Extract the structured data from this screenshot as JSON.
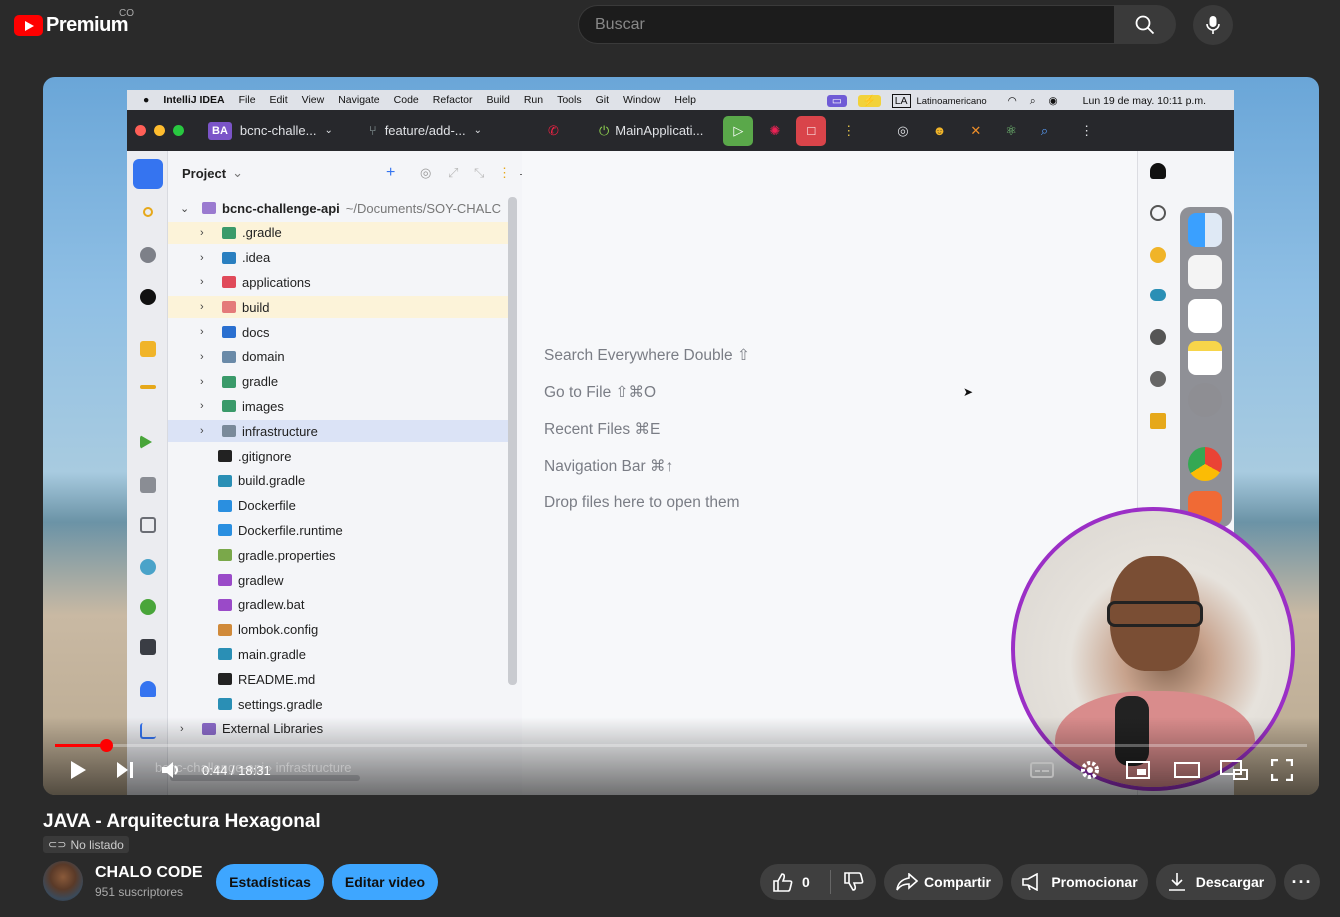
{
  "header": {
    "logo_text": "Premium",
    "country": "CO",
    "search_placeholder": "Buscar"
  },
  "ide": {
    "menubar": {
      "items": [
        "IntelliJ IDEA",
        "File",
        "Edit",
        "View",
        "Navigate",
        "Code",
        "Refactor",
        "Build",
        "Run",
        "Tools",
        "Git",
        "Window",
        "Help"
      ],
      "input_lang": "Latinoamericano",
      "clock": "Lun 19 de may.  10:11 p.m."
    },
    "toolbar": {
      "project_badge": "BA",
      "project": "bcnc-challe...",
      "branch": "feature/add-...",
      "run_config": "MainApplicati..."
    },
    "project_panel": {
      "title": "Project",
      "root": {
        "name": "bcnc-challenge-api",
        "path": "~/Documents/SOY-CHALC"
      },
      "folders": [
        ".gradle",
        ".idea",
        "applications",
        "build",
        "docs",
        "domain",
        "gradle",
        "images",
        "infrastructure"
      ],
      "files": [
        ".gitignore",
        "build.gradle",
        "Dockerfile",
        "Dockerfile.runtime",
        "gradle.properties",
        "gradlew",
        "gradlew.bat",
        "lombok.config",
        "main.gradle",
        "README.md",
        "settings.gradle"
      ],
      "external": "External Libraries"
    },
    "editor_tips": [
      "Search Everywhere Double ⇧",
      "Go to File ⇧⌘O",
      "Recent Files ⌘E",
      "Navigation Bar ⌘↑",
      "Drop files here to open them"
    ]
  },
  "player": {
    "time": "0:44 / 18:31",
    "progress_fraction": 0.041,
    "breadcrumb": "bcnc-challenge-api  ›  infrastructure"
  },
  "video": {
    "title": "JAVA - Arquitectura Hexagonal",
    "visibility": "No listado"
  },
  "channel": {
    "name": "CHALO CODE",
    "subscribers": "951 suscriptores"
  },
  "actions": {
    "stats": "Estadísticas",
    "edit": "Editar video",
    "likes": "0",
    "share": "Compartir",
    "promote": "Promocionar",
    "download": "Descargar"
  }
}
